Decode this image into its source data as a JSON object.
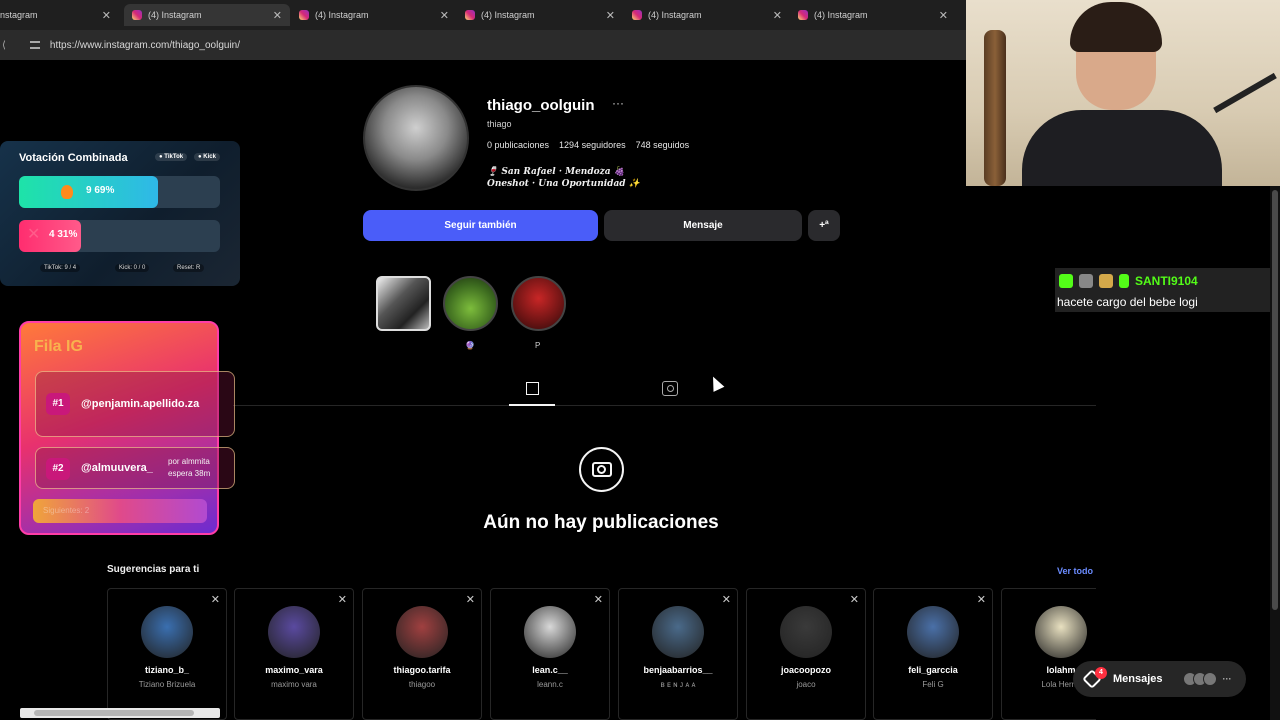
{
  "browser": {
    "tabs": [
      {
        "label": "nstagram"
      },
      {
        "label": "(4) Instagram"
      },
      {
        "label": "(4) Instagram"
      },
      {
        "label": "(4) Instagram"
      },
      {
        "label": "(4) Instagram"
      },
      {
        "label": "(4) Instagram"
      }
    ],
    "url": "https://www.instagram.com/thiago_oolguin/"
  },
  "profile": {
    "username": "thiago_oolguin",
    "more": "···",
    "full_name": "thiago",
    "posts": "0 publicaciones",
    "followers": "1294 seguidores",
    "following": "748 seguidos",
    "bio_line1": "🍷 San Rafael · Mendoza 🍇",
    "bio_line2": "Oneshot · Una Oportunidad ✨",
    "follow_button": "Seguir también",
    "message_button": "Mensaje",
    "add_icon": "+ª"
  },
  "highlights": [
    {
      "label": ""
    },
    {
      "label": "🔮"
    },
    {
      "label": "P"
    }
  ],
  "empty_state": {
    "title": "Aún no hay publicaciones"
  },
  "suggestions": {
    "title": "Sugerencias para ti",
    "see_all": "Ver todo",
    "items": [
      {
        "username": "tiziano_b_",
        "name": "Tiziano Brizuela",
        "color": "#3a6fb0"
      },
      {
        "username": "maximo_vara",
        "name": "maximo vara",
        "color": "#5a4aa0"
      },
      {
        "username": "thiagoo.tarifa",
        "name": "thiagoo",
        "color": "#a04040"
      },
      {
        "username": "lean.c__",
        "name": "leann.c",
        "color": "#d8d8d8"
      },
      {
        "username": "benjaabarrios__",
        "name": "ʙ ᴇ ɴ ᴊ ᴀ ᴀ",
        "color": "#4a6a8a"
      },
      {
        "username": "joacoopozo",
        "name": "joaco",
        "color": "#3a3a3a"
      },
      {
        "username": "feli_garccia",
        "name": "Feli G",
        "color": "#4a70a8"
      },
      {
        "username": "lolahm",
        "name": "Lola Herná",
        "color": "#e8e0c0"
      }
    ]
  },
  "messages": {
    "label": "Mensajes",
    "badge": "4",
    "dots": "···"
  },
  "vote_widget": {
    "title": "Votación Combinada",
    "tag_tiktok": "● TikTok",
    "tag_kick": "● Kick",
    "bar1_text": "9  69%",
    "bar1_percent": 69,
    "bar1_color": "#1ee3a8",
    "bar2_text": "4  31%",
    "bar2_percent": 31,
    "bar2_color": "#ff2d6f",
    "foot_tiktok": "TikTok: 9 / 4",
    "foot_kick": "Kick: 0 / 0",
    "foot_reset": "Reset: R"
  },
  "fila_widget": {
    "title": "Fila IG",
    "entries": [
      {
        "num": "#1",
        "handle": "@penjamin.apellido.za",
        "sub1": "",
        "sub2": ""
      },
      {
        "num": "#2",
        "handle": "@almuuvera_",
        "sub1": "por almmita",
        "sub2": "espera 38m"
      }
    ],
    "footer": "Siguientes: 2"
  },
  "chat": {
    "user": "SANTI9104",
    "message": "hacete cargo del bebe logi"
  }
}
